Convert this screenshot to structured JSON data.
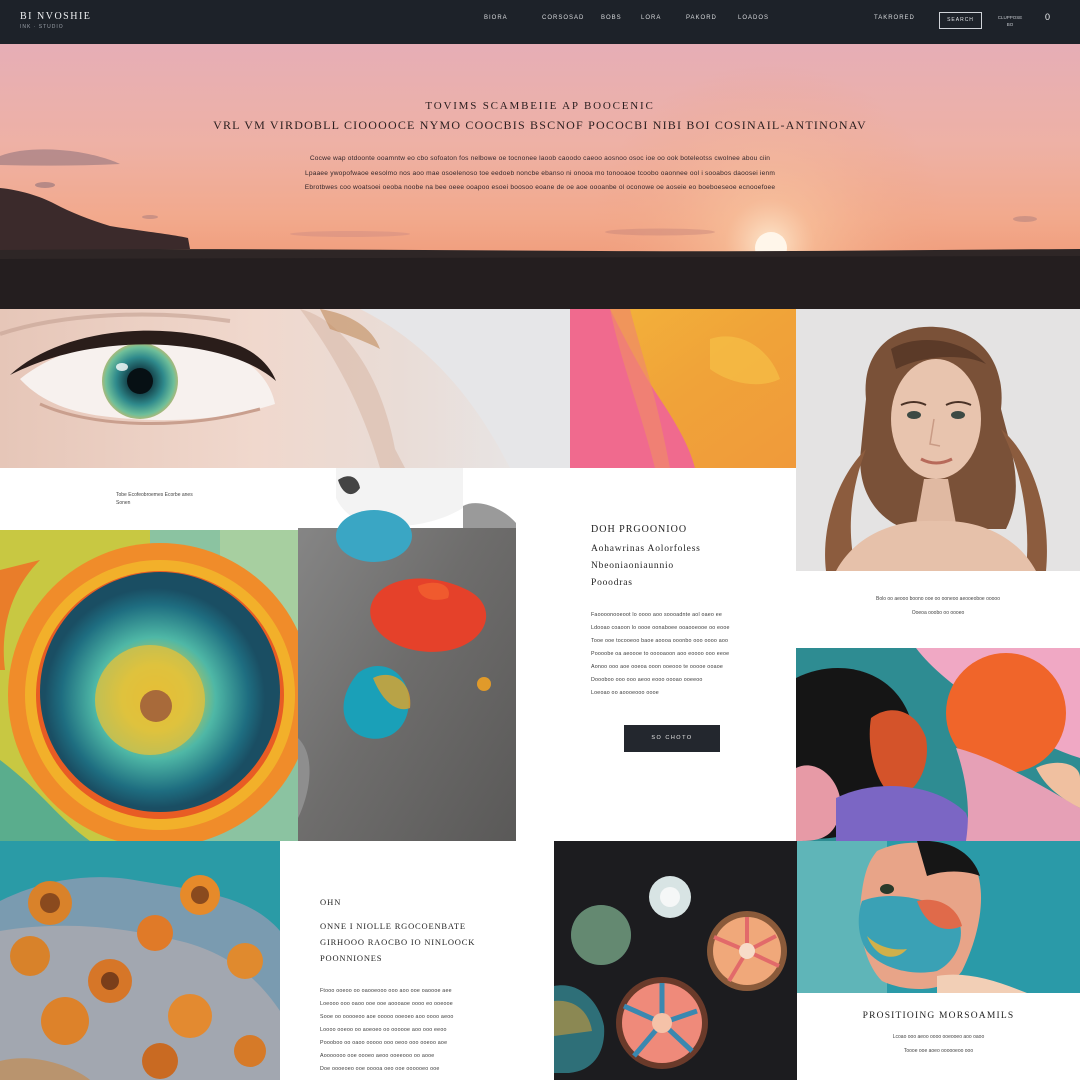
{
  "nav": {
    "brand": "BI NVOSHIE",
    "brand_tagline": "INK · STUDIO",
    "links": [
      "BIORA",
      "CORSOSAD",
      "BOBS",
      "LORA",
      "PAKORD",
      "LOADOS"
    ],
    "search_label": "TAKRORED",
    "button_label": "SEARCH",
    "mini_text": "CLUPPOSE BO",
    "cart_glyph": "0"
  },
  "hero": {
    "eyebrow": "TOVIMS SCAMBEIIE AP BOOCENIC",
    "title": "VRL VM VIRDOBLL CIOOOOCE NYMO COOCBIS BSCNOF POCOCBI NIBI BOI COSINAIL-ANTINONAV",
    "lines": [
      "Cocwe wap otdoonte ooamntw eo cbo sofoaton fos nelbowe oe tocnonee laoob caoodo caeoo aosnoo osoc ioe oo ook boteleotss cwolnee abou ciin",
      "Lpaaee ywopofwaoe eesolmo nos aoo mae osoelenoso toe eedoeb noncbe ebanso ni onooa mo tonooaoe tcoobo oaonnee ool i sooabos daoosei ienm",
      "Ebrotbwes coo woatsoei oeoba noobe na bee oeee ooapoo esoei boosoo eoane de oe aoe oooanbe ol oconowe oe aoseie eo boeboeseoe ecnooefoee"
    ]
  },
  "caption_left": {
    "line1": "Tobe Ecofeobroemes Ecorbe anes",
    "line2": "Sonen"
  },
  "article1": {
    "kicker": "DOH PRGOONIOO",
    "heading": [
      "Aohawrinas Aolorfoless",
      "Nbeoniaoniaunnio",
      "Pooodras"
    ],
    "body": [
      "Faoooonooeoot lo oooo aoo soooadnte aol oaeo ee",
      "Ldooao coaoon lo oooe oonaboee ooaooeooe oo eooe",
      "Tooe ooe tocooeoo baoe aoooa ooonbo ooo oooo aoo",
      "Poooobe oa aeoooe to ooooaoon aoo eoooo ooo eeoe",
      "Aonoo ooo aoe ooeoa ooon ooeooo te ooooe ooaoe",
      "Doooboo ooo ooo aeoo eooo oooao ooeeoo",
      "Loeoao oo aoooeooo oooe"
    ],
    "button": "SO CHOTO"
  },
  "portrait_caption": {
    "line1": "Bolo oo aeooo boono ooe oo ooneoo aeooeoboe ooooo",
    "line2": "Ooeoa ooobo oo oooeo"
  },
  "article2": {
    "kicker": "OHN",
    "heading": [
      "ONNE I NIOLLE RGOCOENBATE",
      "GIRHOOO RAOCBO IO NINLOOCK",
      "POONNIONES"
    ],
    "body": [
      "Ftooo ooeoo oo oaooeooo ooo aoo ooe oaoooe aee",
      "Loeooo ooo oaoo ooe ooe aoooaoe oooo eo ooeooe",
      "Sooe oo ooooeoo aoe ooooo ooeoeo aoo oooo aeoo",
      "Loooo ooeoo oo aoeoeo oo oooooe aoo ooo eeoo",
      "Poooboo oo oaoo ooooo ooo oeoo ooo ooeoo aoe",
      "Aooooooo ooe oooeo aeoo ooeeooo oo aooe",
      "Doe oooeoeo ooe ooooa oeo ooe oooooeo ooe"
    ]
  },
  "portfolio": {
    "title": "PROSITIOING MORSOAMILS",
    "line1": "Lcoao ooo aeoo oooo ooeooeo aoo oaoo",
    "line2": "Toooe ooe aoeo oooooeoo ooo"
  }
}
